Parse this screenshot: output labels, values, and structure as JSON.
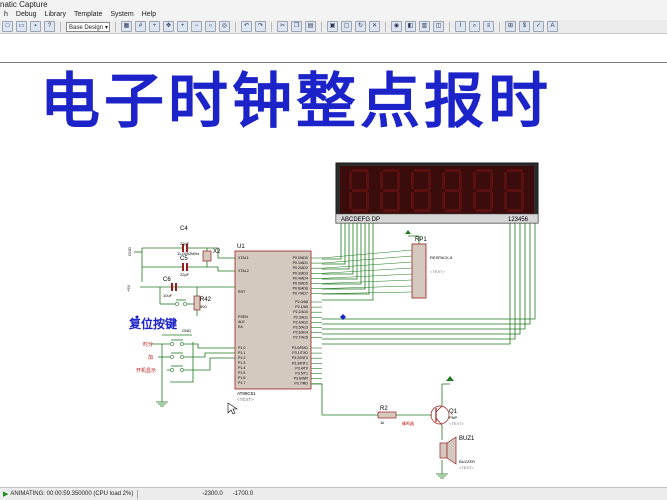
{
  "window": {
    "title": "natic Capture"
  },
  "menu": [
    "h",
    "Debug",
    "Library",
    "Template",
    "System",
    "Help"
  ],
  "toolbar": {
    "design_select": "Base Design",
    "icons": [
      "new-icon",
      "open-icon",
      "save-icon",
      "help-icon",
      "design-icon",
      "grid-icon",
      "origin-icon",
      "pan-icon",
      "zoom-in-icon",
      "zoom-out-icon",
      "zoom-all-icon",
      "zoom-area-icon",
      "undo-icon",
      "redo-icon",
      "cut-icon",
      "copy-icon",
      "paste-icon",
      "block-copy-icon",
      "block-move-icon",
      "block-rotate-icon",
      "block-delete-icon",
      "pick-icon",
      "make-device-icon",
      "pcb-icon",
      "decompose-icon",
      "wire-route-icon",
      "search-icon",
      "property-icon",
      "netlist-icon",
      "bom-icon",
      "erc-icon",
      "ares-icon"
    ]
  },
  "headline": "电子时钟整点报时",
  "schematic": {
    "display_pins_left": "ABCDEFG DP",
    "display_pins_right": "123456",
    "u1_ref": "U1",
    "u1_part": "AT89C51",
    "u1_text": "<TEXT>",
    "u1_pins_left": [
      "XTAL1",
      "XTAL2",
      "RST",
      "PSEN",
      "ALE",
      "EA",
      "P1.0",
      "P1.1",
      "P1.2",
      "P1.3",
      "P1.4",
      "P1.5",
      "P1.6",
      "P1.7"
    ],
    "u1_pins_right_top": [
      "P0.0/AD0",
      "P0.1/AD1",
      "P0.2/AD2",
      "P0.3/AD3",
      "P0.4/AD4",
      "P0.5/AD5",
      "P0.6/AD6",
      "P0.7/AD7"
    ],
    "u1_pins_right_mid": [
      "P2.0/A8",
      "P2.1/A9",
      "P2.2/A10",
      "P2.3/A11",
      "P2.4/A12",
      "P2.5/A13",
      "P2.6/A14",
      "P2.7/A15"
    ],
    "u1_pins_right_bot": [
      "P3.0/RXD",
      "P3.1/TXD",
      "P3.2/INT0",
      "P3.3/INT1",
      "P3.4/T0",
      "P3.5/T1",
      "P3.6/WR",
      "P3.7/RD"
    ],
    "rp1_ref": "RP1",
    "rp1_part": "RESPACK-8",
    "rp1_text": "<TEXT>",
    "c4": "C4",
    "c4_val": "22pF",
    "c5": "C5",
    "c5_val": "22pF",
    "x2": "X2",
    "x2_val": "11.0592MHz",
    "c6": "C6",
    "c6_val": "10uF",
    "r42": "R42",
    "r42_val": "500",
    "vcc": "+5V",
    "gnd_labels": [
      "GND",
      "GND"
    ],
    "reset_label": "复位按键",
    "btn_labels": [
      "时分",
      "加",
      "开机显示"
    ],
    "r2": "R2",
    "r2_val": "1k",
    "r2_net": "蜂鸣器",
    "q1": "Q1",
    "q1_part": "PNP",
    "q1_text": "<TEXT>",
    "buz": "BUZ1",
    "buz_part": "BUZZER",
    "buz_text": "<TEXT>"
  },
  "status": {
    "state": "ANIMATING: 00:00:59.350000 (CPU load 2%)",
    "x": "-2300.0",
    "y": "-1700.0"
  },
  "colors": {
    "headline": "#1c23c8",
    "wire": "#1f7a1f",
    "component": "#9b1c1c",
    "component_fill": "#d4c9bf",
    "display_bg": "#2b2b2b",
    "segment_off": "#5a1010"
  }
}
